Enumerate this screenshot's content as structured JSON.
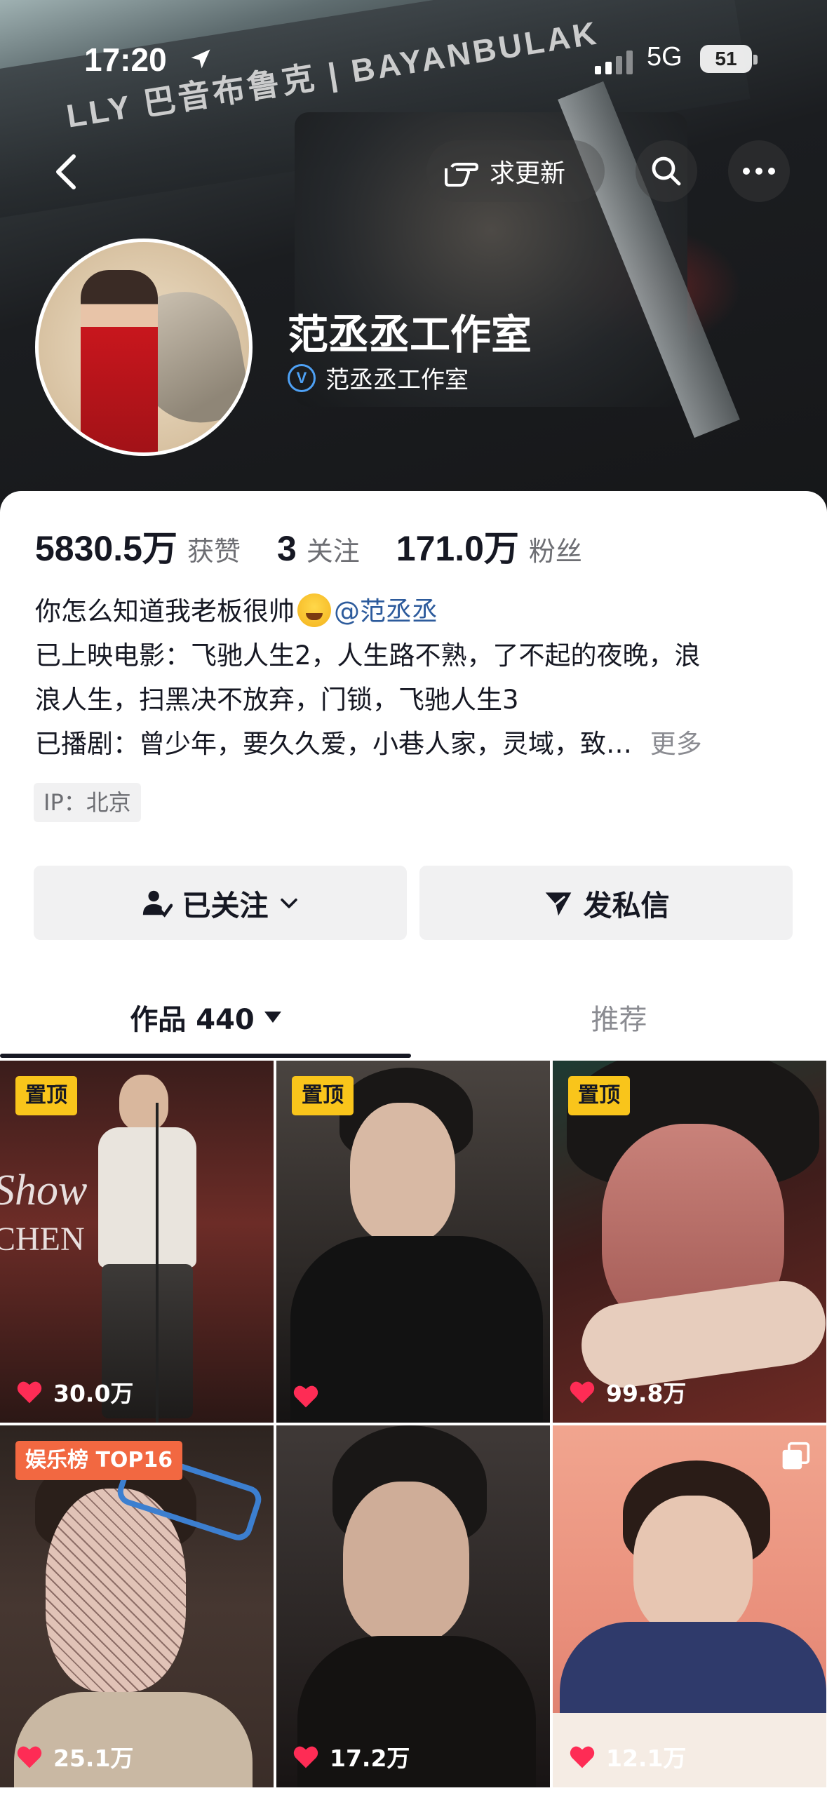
{
  "status_bar": {
    "time": "17:20",
    "network": "5G",
    "battery": "51"
  },
  "header": {
    "request_update_label": "求更新",
    "banner_text": "LLY 巴音布鲁克 | BAYANBULAK"
  },
  "profile": {
    "display_name": "范丞丞工作室",
    "verified_label": "范丞丞工作室",
    "verified_badge": "V"
  },
  "stats": {
    "likes_value": "5830.5万",
    "likes_label": "获赞",
    "following_value": "3",
    "following_label": "关注",
    "followers_value": "171.0万",
    "followers_label": "粉丝"
  },
  "bio": {
    "line1_text": "你怎么知道我老板很帅",
    "line1_mention": "@范丞丞",
    "line2": "已上映电影：飞驰人生2，人生路不熟，了不起的夜晚，浪",
    "line3": "浪人生，扫黑决不放弃，门锁，飞驰人生3",
    "line4": "已播剧：曾少年，要久久爱，小巷人家，灵域，致…",
    "more_label": "更多"
  },
  "ip_tag": "IP：北京",
  "actions": {
    "follow_label": "已关注",
    "message_label": "发私信"
  },
  "tabs": [
    {
      "label": "作品 440"
    },
    {
      "label": "推荐"
    }
  ],
  "videos": [
    {
      "badge": "置顶",
      "likes": "30.0万"
    },
    {
      "badge": "置顶",
      "likes": ""
    },
    {
      "badge": "置顶",
      "likes": "99.8万"
    },
    {
      "badge": "娱乐榜 TOP16",
      "likes": "25.1万"
    },
    {
      "badge": "",
      "likes": "17.2万"
    },
    {
      "badge": "",
      "likes": "12.1万"
    }
  ],
  "video1_overlay": {
    "line1": "Show",
    "line2": "CHEN"
  },
  "colors": {
    "accent_badge": "#f9c51b",
    "rank_badge": "#f26841",
    "heart": "#fe2c55",
    "mention": "#2d5b9c",
    "verified": "#4ea1f5"
  }
}
